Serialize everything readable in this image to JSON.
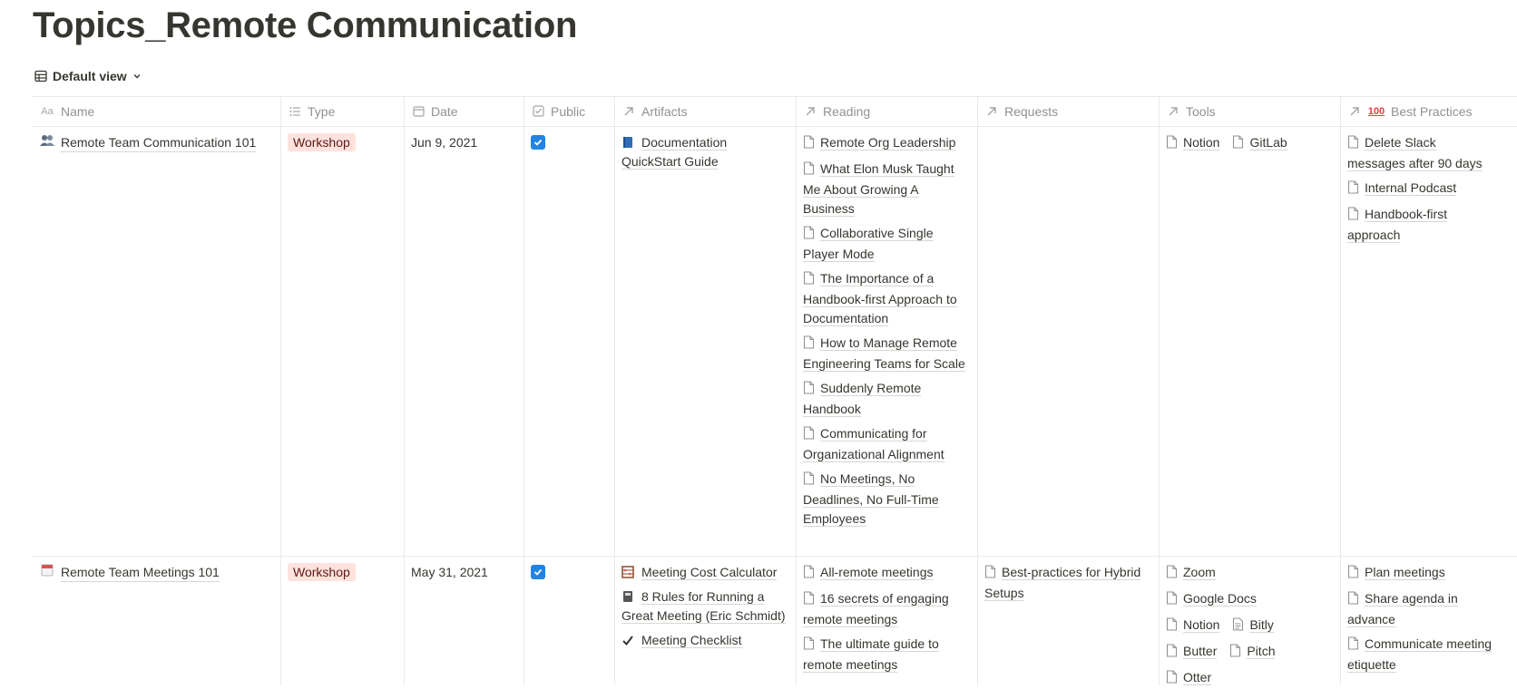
{
  "page": {
    "title": "Topics_Remote Communication"
  },
  "view": {
    "label": "Default view"
  },
  "columns": {
    "name": "Name",
    "type": "Type",
    "date": "Date",
    "public": "Public",
    "artifacts": "Artifacts",
    "reading": "Reading",
    "requests": "Requests",
    "tools": "Tools",
    "best_practices": "Best Practices"
  },
  "rows": [
    {
      "name": "Remote Team Communication 101",
      "icon": "busts-in-silhouette-emoji",
      "type": "Workshop",
      "date": "Jun 9, 2021",
      "public": true,
      "artifacts": [
        "Documentation QuickStart Guide"
      ],
      "reading": [
        "Remote Org Leadership",
        "What Elon Musk Taught Me About Growing A Business",
        "Collaborative Single Player Mode",
        "The Importance of a Handbook-first Approach to Documentation",
        "How to Manage Remote Engineering Teams for Scale",
        "Suddenly Remote Handbook",
        "Communicating for Organizational Alignment",
        "No Meetings, No Deadlines, No Full-Time Employees"
      ],
      "requests": [],
      "tools": [
        "Notion",
        "GitLab"
      ],
      "best_practices": [
        "Delete Slack messages after 90 days",
        "Internal Podcast",
        "Handbook-first approach"
      ]
    },
    {
      "name": "Remote Team Meetings 101",
      "icon": "calendar-emoji",
      "type": "Workshop",
      "date": "May 31, 2021",
      "public": true,
      "artifacts": [
        "Meeting Cost Calculator",
        "8 Rules for Running a Great Meeting (Eric Schmidt)",
        "Meeting Checklist"
      ],
      "reading": [
        "All-remote meetings",
        "16 secrets of engaging remote meetings",
        "The ultimate guide to remote meetings"
      ],
      "requests": [
        "Best-practices for Hybrid Setups"
      ],
      "tools": [
        "Zoom",
        "Google Docs",
        "Notion",
        "Bitly",
        "Butter",
        "Pitch",
        "Otter"
      ],
      "best_practices": [
        "Plan meetings",
        "Share agenda in advance",
        "Communicate meeting etiquette"
      ]
    }
  ]
}
